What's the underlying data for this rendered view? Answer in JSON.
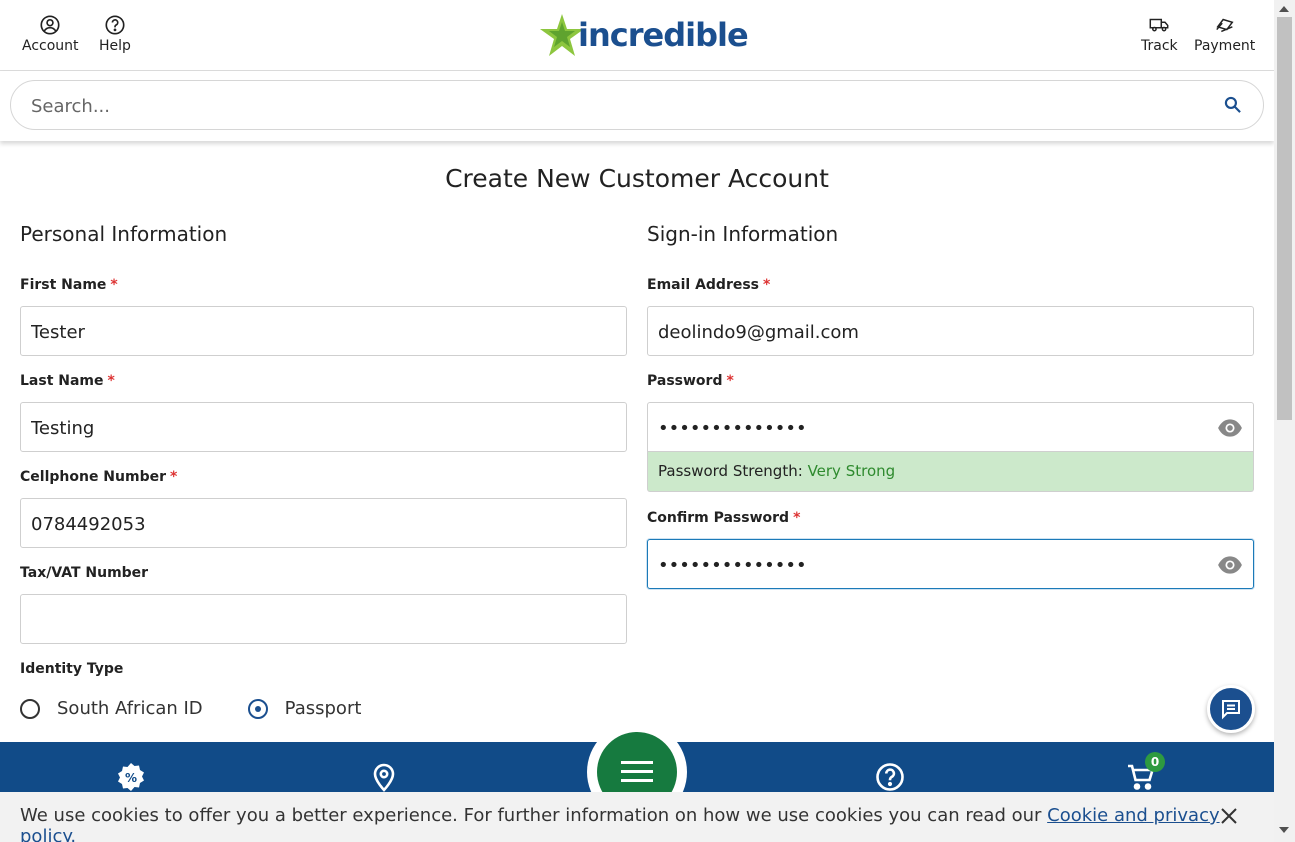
{
  "header": {
    "account_label": "Account",
    "help_label": "Help",
    "logo_text": "incredible",
    "track_label": "Track",
    "payment_label": "Payment"
  },
  "search": {
    "placeholder": "Search..."
  },
  "page": {
    "title": "Create New Customer Account"
  },
  "personal": {
    "title": "Personal Information",
    "first_name_label": "First Name",
    "first_name_value": "Tester",
    "last_name_label": "Last Name",
    "last_name_value": "Testing",
    "cellphone_label": "Cellphone Number",
    "cellphone_value": "0784492053",
    "tax_label": "Tax/VAT Number",
    "tax_value": "",
    "identity_label": "Identity Type",
    "identity_options": [
      "South African ID",
      "Passport"
    ],
    "identity_selected": "Passport",
    "required_marker": "*"
  },
  "signin": {
    "title": "Sign-in Information",
    "email_label": "Email Address",
    "email_value": "deolindo9@gmail.com",
    "password_label": "Password",
    "password_value": "••••••••••••••",
    "strength_label": "Password Strength:",
    "strength_value": "Very Strong",
    "confirm_label": "Confirm Password",
    "confirm_value": "••••••••••••••"
  },
  "cart": {
    "count": "0"
  },
  "cookie": {
    "text": "We use cookies to offer you a better experience. For further information on how we use cookies you can read our ",
    "link_text": "Cookie and privacy policy."
  },
  "colors": {
    "brand_blue": "#1b4f8f",
    "nav_blue": "#114b88",
    "menu_green": "#167a3f",
    "logo_star_green": "#8dc63f",
    "strength_bg": "#cce9cb"
  },
  "icons": {
    "account": "account-circle-icon",
    "help": "help-circle-icon",
    "track": "truck-icon",
    "payment": "payment-icon",
    "search": "search-icon",
    "eye": "eye-icon",
    "chat": "chat-icon",
    "specials": "percent-badge-icon",
    "stores": "location-pin-icon",
    "menu": "hamburger-menu-icon",
    "faq": "help-circle-icon",
    "cart": "cart-icon",
    "close": "close-icon"
  }
}
